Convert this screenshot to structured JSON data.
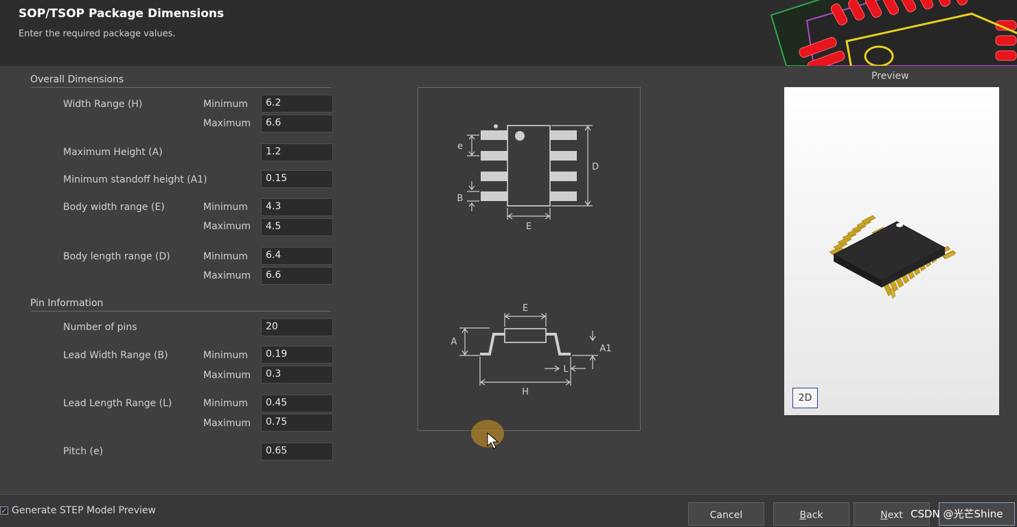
{
  "header": {
    "title": "SOP/TSOP Package Dimensions",
    "subtitle": "Enter the required package values."
  },
  "overall": {
    "title": "Overall Dimensions",
    "width_range": {
      "label": "Width Range (H)",
      "min_label": "Minimum",
      "min": "6.2",
      "max_label": "Maximum",
      "max": "6.6"
    },
    "max_height": {
      "label": "Maximum Height (A)",
      "value": "1.2"
    },
    "standoff": {
      "label": "Minimum standoff height (A1)",
      "value": "0.15"
    },
    "body_width": {
      "label": "Body width range (E)",
      "min_label": "Minimum",
      "min": "4.3",
      "max_label": "Maximum",
      "max": "4.5"
    },
    "body_length": {
      "label": "Body length range (D)",
      "min_label": "Minimum",
      "min": "6.4",
      "max_label": "Maximum",
      "max": "6.6"
    }
  },
  "pins": {
    "title": "Pin Information",
    "num_pins": {
      "label": "Number of pins",
      "value": "20"
    },
    "lead_width": {
      "label": "Lead Width Range (B)",
      "min_label": "Minimum",
      "min": "0.19",
      "max_label": "Maximum",
      "max": "0.3"
    },
    "lead_length": {
      "label": "Lead Length Range (L)",
      "min_label": "Minimum",
      "min": "0.45",
      "max_label": "Maximum",
      "max": "0.75"
    },
    "pitch": {
      "label": "Pitch (e)",
      "value": "0.65"
    }
  },
  "diagram": {
    "top": {
      "e": "e",
      "b": "B",
      "d": "D",
      "e_body": "E"
    },
    "side": {
      "e_top": "E",
      "a": "A",
      "a1": "A1",
      "l": "L",
      "h": "H"
    }
  },
  "preview": {
    "label": "Preview",
    "mode_button": "2D",
    "chip_body_color": "#2b2b2b",
    "lead_color": "#c9a227"
  },
  "footer": {
    "generate_step_label": "Generate STEP Model Preview",
    "generate_step_checked": true,
    "cancel": "Cancel",
    "back_rest": "ack",
    "back_mnemonic": "B",
    "next_rest": "ext",
    "next_mnemonic": "N"
  },
  "watermark": "CSDN @光芒Shine",
  "colors": {
    "header_bg": "#2d2d2d",
    "body_bg": "#3f3f3f",
    "pcb_pad_red": "#e8141e",
    "pcb_outline_yellow": "#e8d21e",
    "pcb_trace_purple": "#b04ac8"
  }
}
